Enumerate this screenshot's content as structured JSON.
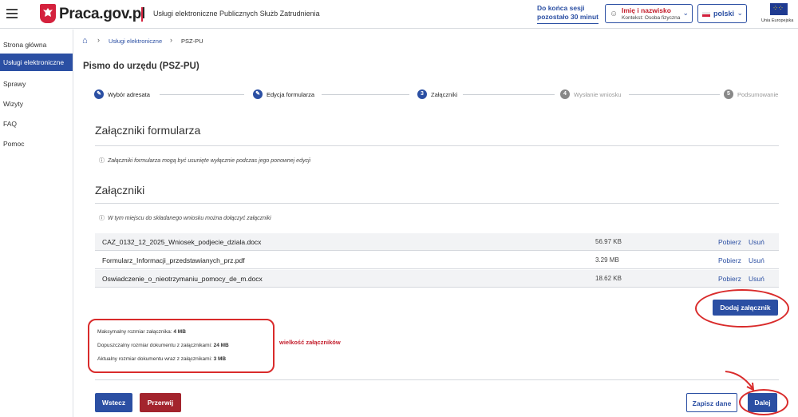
{
  "header": {
    "logo": "Praca.gov.pl",
    "subtitle": "Usługi elektroniczne Publicznych Służb Zatrudnienia",
    "session_line1": "Do końca sesji",
    "session_line2": "pozostało 30 minut",
    "user_name": "Imię i nazwisko",
    "user_context": "Kontekst: Osoba fizyczna",
    "language": "polski",
    "eu_label": "Unia Europejska"
  },
  "sidebar": {
    "items": [
      {
        "label": "Strona główna"
      },
      {
        "label": "Usługi elektroniczne"
      },
      {
        "label": "Sprawy"
      },
      {
        "label": "Wizyty"
      },
      {
        "label": "FAQ"
      },
      {
        "label": "Pomoc"
      }
    ],
    "active_index": 1
  },
  "breadcrumb": {
    "items": [
      "Usługi elektroniczne",
      "PSZ-PU"
    ]
  },
  "page_title": "Pismo do urzędu (PSZ-PU)",
  "steps": [
    {
      "label": "Wybór adresata",
      "state": "done",
      "num": ""
    },
    {
      "label": "Edycja formularza",
      "state": "done",
      "num": ""
    },
    {
      "label": "Załączniki",
      "state": "current",
      "num": "3"
    },
    {
      "label": "Wysłanie wniosku",
      "state": "future",
      "num": "4"
    },
    {
      "label": "Podsumowanie",
      "state": "future",
      "num": "5"
    }
  ],
  "section1": {
    "title": "Załączniki formularza",
    "info": "Załączniki formularza mogą być usunięte wyłącznie podczas jego ponownej edycji"
  },
  "section2": {
    "title": "Załączniki",
    "info": "W tym miejscu do składanego wniosku można dołączyć załączniki"
  },
  "attachments": {
    "download_label": "Pobierz",
    "remove_label": "Usuń",
    "rows": [
      {
        "name": "CAZ_0132_12_2025_Wniosek_podjecie_dziala.docx",
        "size": "56.97 KB"
      },
      {
        "name": "Formularz_Informacji_przedstawianych_prz.pdf",
        "size": "3.29 MB"
      },
      {
        "name": "Oswiadczenie_o_nieotrzymaniu_pomocy_de_m.docx",
        "size": "18.62 KB"
      }
    ]
  },
  "add_button": "Dodaj załącznik",
  "limits": {
    "max_attachment_label": "Maksymalny rozmiar załącznika:",
    "max_attachment_value": "4 MB",
    "allowed_doc_label": "Dopuszczalny rozmiar dokumentu z załącznikami:",
    "allowed_doc_value": "24 MB",
    "current_doc_label": "Aktualny rozmiar dokumentu wraz z załącznikami:",
    "current_doc_value": "3 MB"
  },
  "annotation": "wielkość załączników",
  "footer": {
    "back": "Wstecz",
    "break": "Przerwij",
    "save": "Zapisz dane",
    "next": "Dalej"
  },
  "colors": {
    "primary": "#2b4fa3",
    "danger": "#a3242d",
    "annotation": "#d92b2b"
  }
}
